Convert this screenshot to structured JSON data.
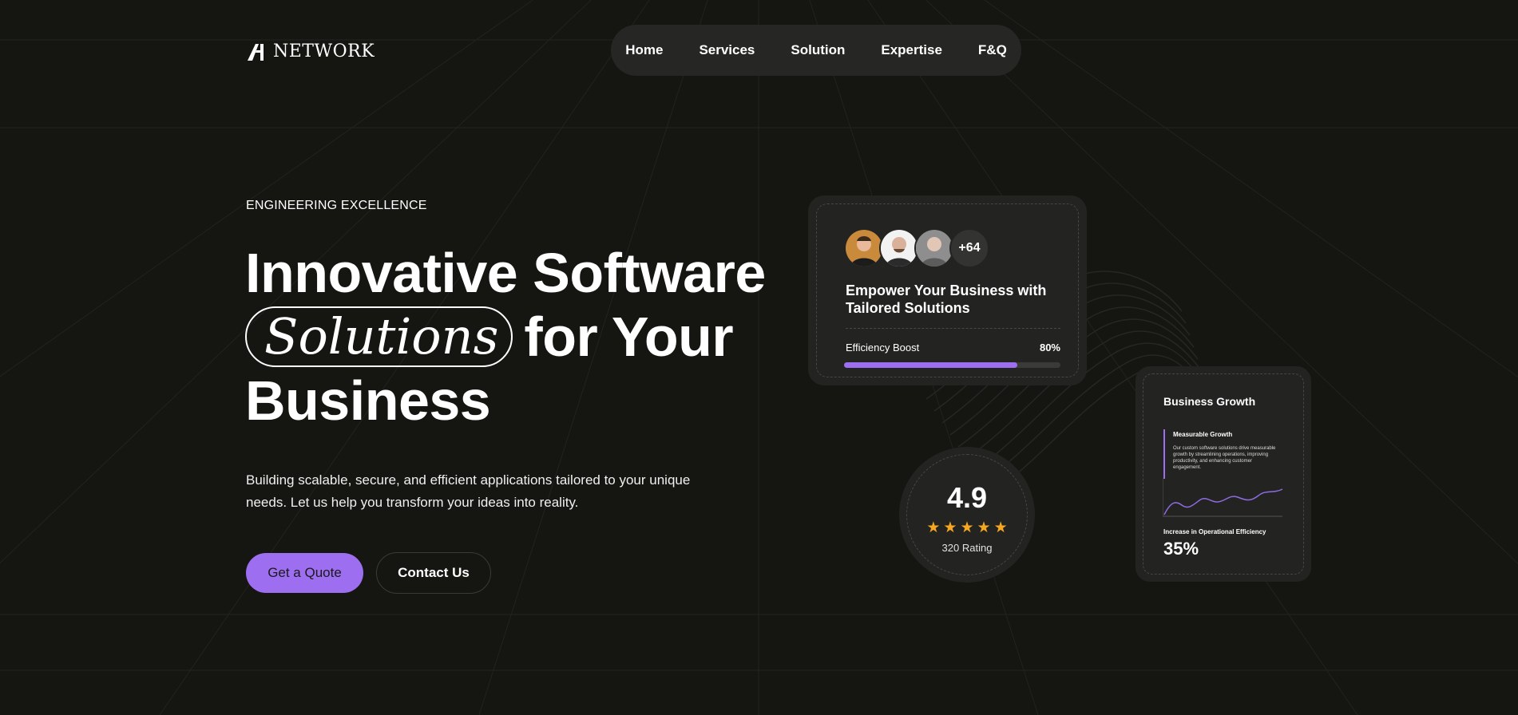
{
  "brand": {
    "name": "NETWORK"
  },
  "nav": {
    "items": [
      "Home",
      "Services",
      "Solution",
      "Expertise",
      "F&Q"
    ]
  },
  "hero": {
    "eyebrow": "ENGINEERING EXCELLENCE",
    "headline_line1": "Innovative Software",
    "headline_highlight": "Solutions",
    "headline_line2_rest": "for Your",
    "headline_line3": "Business",
    "subtext": "Building scalable, secure, and efficient applications tailored to your unique needs. Let us help you transform your ideas into reality.",
    "primary_button": "Get a Quote",
    "secondary_button": "Contact Us"
  },
  "card_empower": {
    "more_count": "+64",
    "title": "Empower Your Business with Tailored Solutions",
    "metric_label": "Efficiency Boost",
    "metric_value": "80%",
    "progress_fraction": 0.8
  },
  "rating": {
    "score": "4.9",
    "stars": 5,
    "count_label": "320 Rating"
  },
  "card_growth": {
    "title": "Business Growth",
    "subtitle": "Measurable Growth",
    "description": "Our custom software solutions drive measurable growth by streamlining operations, improving productivity, and enhancing customer engagement.",
    "increase_label": "Increase in Operational Efficiency",
    "increase_value": "35%"
  },
  "colors": {
    "accent": "#9d6ef0",
    "background": "#151512",
    "card": "#232322",
    "star": "#f5a623"
  },
  "icons": [
    "logo-mark-icon",
    "star-icon"
  ]
}
